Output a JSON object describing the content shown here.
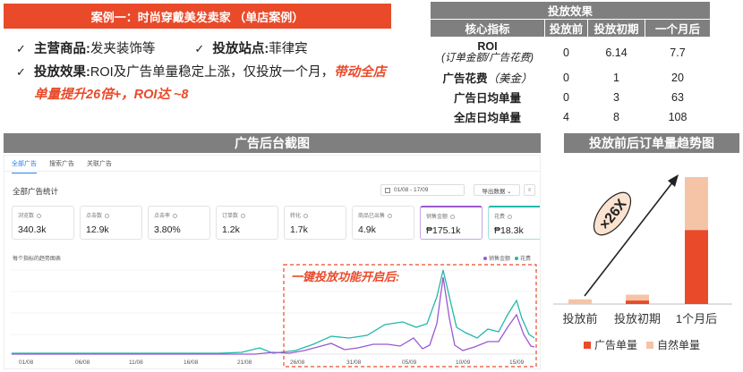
{
  "banner": {
    "text": "案例一：时尚穿戴美发卖家 （单店案例）"
  },
  "bullets": {
    "check": "✓",
    "main_goods_label": "主营商品:",
    "main_goods_value": " 发夹装饰等",
    "site_label": "投放站点:",
    "site_value": " 菲律宾",
    "effect_label": "投放效果:",
    "effect_text": " ROI及广告单量稳定上涨，仅投放一个月，",
    "effect_highlight_1": "带动全店",
    "effect_highlight_2": "单量提升26倍+，ROI达 ~8"
  },
  "results_table": {
    "title": "投放效果",
    "headers": [
      "核心指标",
      "投放前",
      "投放初期",
      "一个月后"
    ],
    "rows": [
      {
        "label": "ROI",
        "sub": "(订单金额/广告花费)",
        "values": [
          "0",
          "6.14",
          "7.7"
        ]
      },
      {
        "label": "广告花费",
        "sub": "（美金）",
        "values": [
          "0",
          "1",
          "20"
        ]
      },
      {
        "label": "广告日均单量",
        "sub": "",
        "values": [
          "0",
          "3",
          "63"
        ]
      },
      {
        "label": "全店日均单量",
        "sub": "",
        "values": [
          "4",
          "8",
          "108"
        ]
      }
    ]
  },
  "section_titles": {
    "dashboard": "广告后台截图",
    "trend": "投放前后订单量趋势图"
  },
  "dashboard": {
    "tabs": [
      "全部广告",
      "搜索广告",
      "关联广告"
    ],
    "title": "全部广告统计",
    "date_range": "01/08 - 17/09",
    "export_label": "导出数据 ⌄",
    "menu_glyph": "≡",
    "metrics": [
      {
        "label": "浏览数",
        "value": "340.3k"
      },
      {
        "label": "点击数",
        "value": "12.9k"
      },
      {
        "label": "点击率",
        "value": "3.80%"
      },
      {
        "label": "订单数",
        "value": "1.2k"
      },
      {
        "label": "转化",
        "value": "1.7k"
      },
      {
        "label": "商品已出售",
        "value": "4.9k"
      },
      {
        "label": "销售金额",
        "value": "₱175.1k"
      },
      {
        "label": "花费",
        "value": "₱18.3k"
      }
    ],
    "trend_title": "每个指标的趋势图表",
    "legend": [
      {
        "name": "销售金额",
        "color": "#9b59d0"
      },
      {
        "name": "花费",
        "color": "#22b8a8"
      }
    ],
    "annotation": "一键投放功能开启后:",
    "x_ticks": [
      "01/08",
      "06/08",
      "11/08",
      "16/08",
      "21/08",
      "26/08",
      "31/08",
      "05/09",
      "10/09",
      "15/09"
    ]
  },
  "chart_data": {
    "type": "bar",
    "title": "投放前后订单量趋势图",
    "categories": [
      "投放前",
      "投放初期",
      "1个月后"
    ],
    "series": [
      {
        "name": "广告单量",
        "values": [
          0,
          3,
          63
        ],
        "color": "#e94a2a"
      },
      {
        "name": "自然单量",
        "values": [
          4,
          5,
          45
        ],
        "color": "#f5c4a6"
      }
    ],
    "annotation": "×26X",
    "stacked": true
  }
}
